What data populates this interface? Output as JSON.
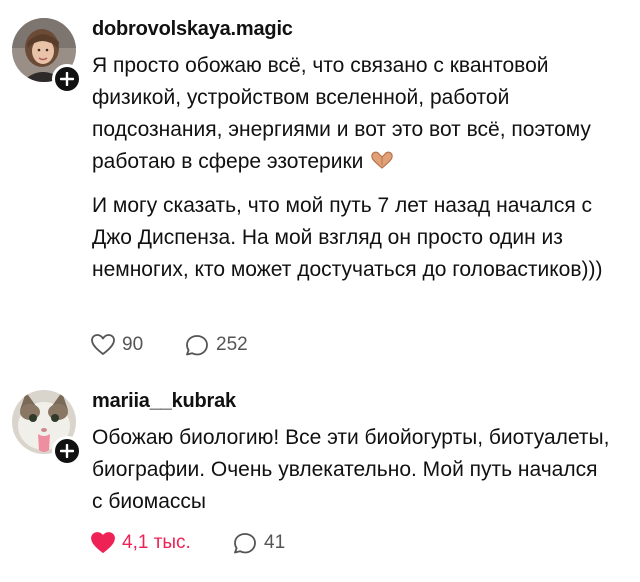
{
  "posts": [
    {
      "username": "dobrovolskaya.magic",
      "paragraphs": [
        "Я просто обожаю всё, что связано с квантовой физикой, устройством вселенной, работой подсознания, энергиями и вот это вот всё, поэтому работаю в сфере эзотерики",
        "И могу сказать, что мой путь 7 лет назад начался с Джо Диспенза. На мой взгляд он просто один из немногих, кто может достучаться до головастиков)))"
      ],
      "likes": "90",
      "comments": "252",
      "liked": false,
      "emoji_icon": "heart-hands-icon"
    },
    {
      "username": "mariia__kubrak",
      "paragraphs": [
        "Обожаю биологию! Все эти биойогурты, биотуалеты, биографии. Очень увлекательно. Мой путь начался с биомассы"
      ],
      "likes": "4,1 тыс.",
      "comments": "41",
      "liked": true
    }
  ],
  "colors": {
    "liked": "#ee2255",
    "muted": "#555555",
    "text": "#111111"
  }
}
